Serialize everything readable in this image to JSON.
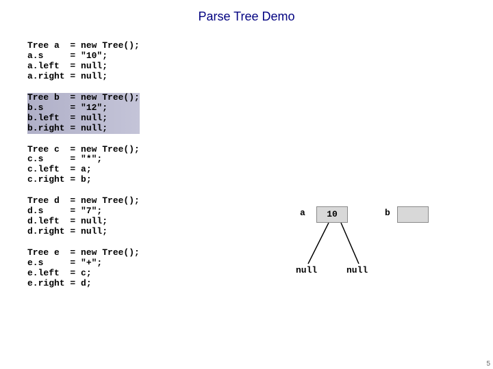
{
  "title": "Parse Tree Demo",
  "code": {
    "blocks": [
      {
        "text": "Tree a  = new Tree();\na.s     = \"10\";\na.left  = null;\na.right = null;",
        "highlight": false
      },
      {
        "text": "Tree b  = new Tree();\nb.s     = \"12\";\nb.left  = null;\nb.right = null;",
        "highlight": true
      },
      {
        "text": "Tree c  = new Tree();\nc.s     = \"*\";\nc.left  = a;\nc.right = b;",
        "highlight": false
      },
      {
        "text": "Tree d  = new Tree();\nd.s     = \"7\";\nd.left  = null;\nd.right = null;",
        "highlight": false
      },
      {
        "text": "Tree e  = new Tree();\ne.s     = \"+\";\ne.left  = c;\ne.right = d;",
        "highlight": false
      }
    ]
  },
  "diagram": {
    "node_a": {
      "label": "a",
      "value": "10"
    },
    "node_b": {
      "label": "b",
      "value": ""
    },
    "leaves": {
      "left": "null",
      "right": "null"
    }
  },
  "page_number": "5"
}
